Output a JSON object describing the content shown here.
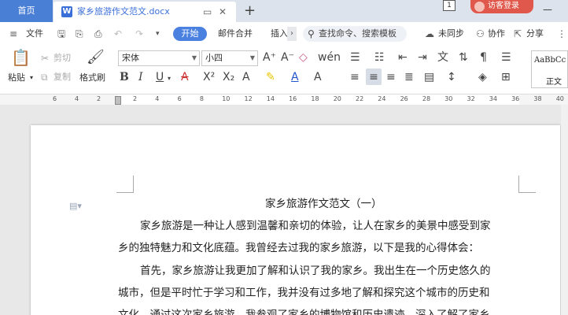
{
  "titlebar": {
    "home_label": "首页",
    "doc_title": "家乡旅游作文范文.docx",
    "new_tab_icon": "+",
    "window_count": "1",
    "login_label": "访客登录"
  },
  "menubar": {
    "file_label": "文件",
    "start_label": "开始",
    "mail_merge_label": "邮件合并",
    "insert_label": "插入",
    "search_placeholder": "查找命令、搜索模板",
    "unsynced_label": "未同步",
    "collab_label": "协作",
    "share_label": "分享"
  },
  "ribbon": {
    "paste_label": "粘贴",
    "cut_label": "剪切",
    "copy_label": "复制",
    "format_painter_label": "格式刷",
    "font_name": "宋体",
    "font_size": "小四",
    "style_sample": "AaBbCc",
    "style_name": "正文"
  },
  "ruler": {
    "ticks": [
      "6",
      "4",
      "2",
      "2",
      "4",
      "6",
      "8",
      "10",
      "12",
      "14",
      "16",
      "18",
      "20",
      "22",
      "24",
      "26",
      "28",
      "30",
      "32",
      "34",
      "36",
      "38",
      "40"
    ]
  },
  "document": {
    "title": "家乡旅游作文范文（一）",
    "lines": [
      "家乡旅游是一种让人感到温馨和亲切的体验，让人在家乡的美景中感受到家",
      "乡的独特魅力和文化底蕴。我曾经去过我的家乡旅游，以下是我的心得体会：",
      "首先，家乡旅游让我更加了解和认识了我的家乡。我出生在一个历史悠久的",
      "城市，但是平时忙于学习和工作，我并没有过多地了解和探究这个城市的历史和",
      "文化。通过这次家乡旅游，我参观了家乡的博物馆和历史遗迹，深入了解了家乡"
    ]
  },
  "colors": {
    "accent": "#4a80e0",
    "login": "#e0574b",
    "titlebar_bg": "#dde3ec"
  }
}
